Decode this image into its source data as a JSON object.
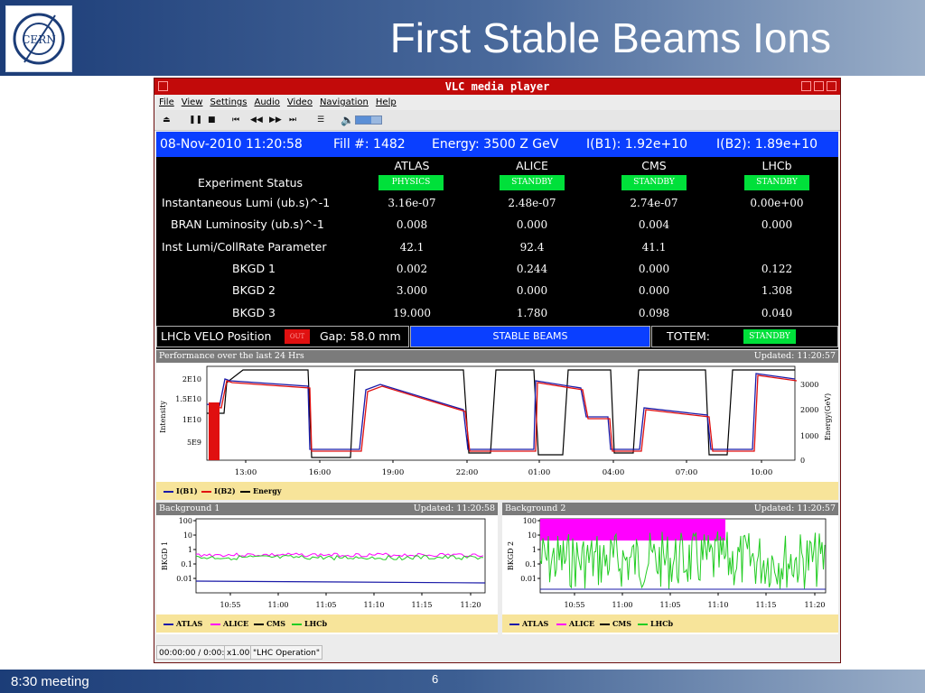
{
  "slide": {
    "title": "First Stable Beams Ions",
    "footer_left": "8:30 meeting",
    "page": "6",
    "logo_text": "CERN"
  },
  "window": {
    "title": "VLC media player",
    "menu": [
      "File",
      "View",
      "Settings",
      "Audio",
      "Video",
      "Navigation",
      "Help"
    ]
  },
  "status_strip": {
    "datetime": "08-Nov-2010 11:20:58",
    "fill": "Fill #: 1482",
    "energy": "Energy: 3500 Z GeV",
    "ib1": "I(B1): 1.92e+10",
    "ib2": "I(B2): 1.89e+10"
  },
  "experiments": {
    "columns": [
      "ATLAS",
      "ALICE",
      "CMS",
      "LHCb"
    ],
    "status_label": "Experiment Status",
    "statuses": [
      "PHYSICS",
      "STANDBY",
      "STANDBY",
      "STANDBY"
    ],
    "rows": [
      {
        "label": "Instantaneous Lumi (ub.s)^-1",
        "values": [
          "3.16e-07",
          "2.48e-07",
          "2.74e-07",
          "0.00e+00"
        ]
      },
      {
        "label": "BRAN Luminosity (ub.s)^-1",
        "values": [
          "0.008",
          "0.000",
          "0.004",
          "0.000"
        ]
      },
      {
        "label": "Inst Lumi/CollRate Parameter",
        "values": [
          "42.1",
          "92.4",
          "41.1",
          ""
        ]
      },
      {
        "label": "BKGD 1",
        "values": [
          "0.002",
          "0.244",
          "0.000",
          "0.122"
        ]
      },
      {
        "label": "BKGD 2",
        "values": [
          "3.000",
          "0.000",
          "0.000",
          "1.308"
        ]
      },
      {
        "label": "BKGD 3",
        "values": [
          "19.000",
          "1.780",
          "0.098",
          "0.040"
        ]
      }
    ]
  },
  "velo": {
    "label": "LHCb VELO Position",
    "state": "OUT",
    "gap": "Gap: 58.0 mm",
    "beam_mode": "STABLE BEAMS",
    "totem_label": "TOTEM:",
    "totem_state": "STANDBY"
  },
  "colors": {
    "physics": "#00e03a",
    "standby": "#00e03a",
    "out": "#e01010",
    "beam_mode": "#0a3fff",
    "b1": "#1a1aa8",
    "b2": "#e01010",
    "energy": "#000000",
    "atlas": "#1a1aa8",
    "alice": "#ff00ff",
    "cms": "#000000",
    "lhcb": "#22cc22"
  },
  "perf": {
    "title": "Performance over the last 24 Hrs",
    "updated": "Updated: 11:20:57",
    "ylabel_left": "Intensity",
    "ylabel_right": "Energy(GeV)",
    "yticks_left": [
      "2E10",
      "1.5E10",
      "1E10",
      "5E9"
    ],
    "yticks_right": [
      "3000",
      "2000",
      "1000",
      "0"
    ],
    "xticks": [
      "13:00",
      "16:00",
      "19:00",
      "22:00",
      "01:00",
      "04:00",
      "07:00",
      "10:00"
    ],
    "legend": [
      "I(B1)",
      "I(B2)",
      "Energy"
    ]
  },
  "bg1": {
    "title": "Background 1",
    "updated": "Updated: 11:20:58",
    "ylabel": "BKGD 1",
    "yticks": [
      "100",
      "10",
      "1",
      "0.1",
      "0.01"
    ],
    "xticks": [
      "10:55",
      "11:00",
      "11:05",
      "11:10",
      "11:15",
      "11:20"
    ],
    "legend": [
      "ATLAS",
      "ALICE",
      "CMS",
      "LHCb"
    ]
  },
  "bg2": {
    "title": "Background 2",
    "updated": "Updated: 11:20:57",
    "ylabel": "BKGD 2",
    "yticks": [
      "100",
      "10",
      "1",
      "0.1",
      "0.01"
    ],
    "xticks": [
      "10:55",
      "11:00",
      "11:05",
      "11:10",
      "11:15",
      "11:20"
    ],
    "legend": [
      "ATLAS",
      "ALICE",
      "CMS",
      "LHCb"
    ]
  },
  "player_status": {
    "time": "00:00:00 / 0:00:",
    "speed": "x1.00",
    "title": "\"LHC Operation\""
  }
}
